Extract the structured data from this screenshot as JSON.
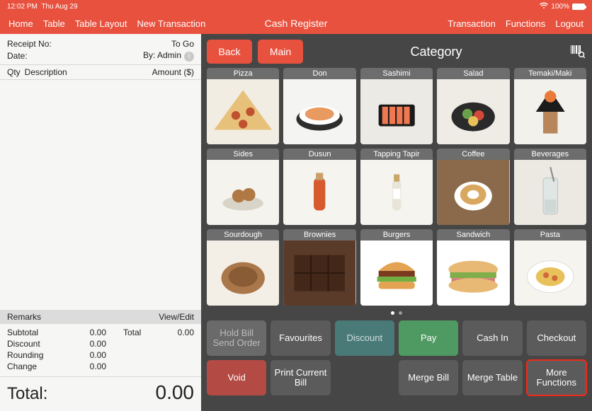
{
  "statusbar": {
    "time": "12:02 PM",
    "date": "Thu Aug 29",
    "battery": "100%"
  },
  "nav": {
    "left": [
      "Home",
      "Table",
      "Table Layout",
      "New Transaction"
    ],
    "center": "Cash Register",
    "right": [
      "Transaction",
      "Functions",
      "Logout"
    ]
  },
  "receipt": {
    "no_label": "Receipt No:",
    "type": "To Go",
    "date_label": "Date:",
    "by": "By: Admin",
    "qty_label": "Qty",
    "desc_label": "Description",
    "amount_label": "Amount ($)"
  },
  "remarks": {
    "label": "Remarks",
    "action": "View/Edit"
  },
  "totals": {
    "rows": [
      {
        "label": "Subtotal",
        "value": "0.00",
        "extra_label": "Total",
        "extra_value": "0.00"
      },
      {
        "label": "Discount",
        "value": "0.00"
      },
      {
        "label": "Rounding",
        "value": "0.00"
      },
      {
        "label": "Change",
        "value": "0.00"
      }
    ],
    "grand_label": "Total:",
    "grand_value": "0.00"
  },
  "right": {
    "back": "Back",
    "main": "Main",
    "title": "Category",
    "categories": [
      "Pizza",
      "Don",
      "Sashimi",
      "Salad",
      "Temaki/Maki",
      "Sides",
      "Dusun",
      "Tapping Tapir",
      "Coffee",
      "Beverages",
      "Sourdough",
      "Brownies",
      "Burgers",
      "Sandwich",
      "Pasta"
    ]
  },
  "actions": {
    "hold": "Hold Bill Send Order",
    "favourites": "Favourites",
    "discount": "Discount",
    "pay": "Pay",
    "cashin": "Cash In",
    "checkout": "Checkout",
    "void": "Void",
    "print": "Print Current Bill",
    "mergebill": "Merge Bill",
    "mergetable": "Merge Table",
    "more": "More Functions"
  },
  "colors": {
    "brand": "#e8513e"
  }
}
